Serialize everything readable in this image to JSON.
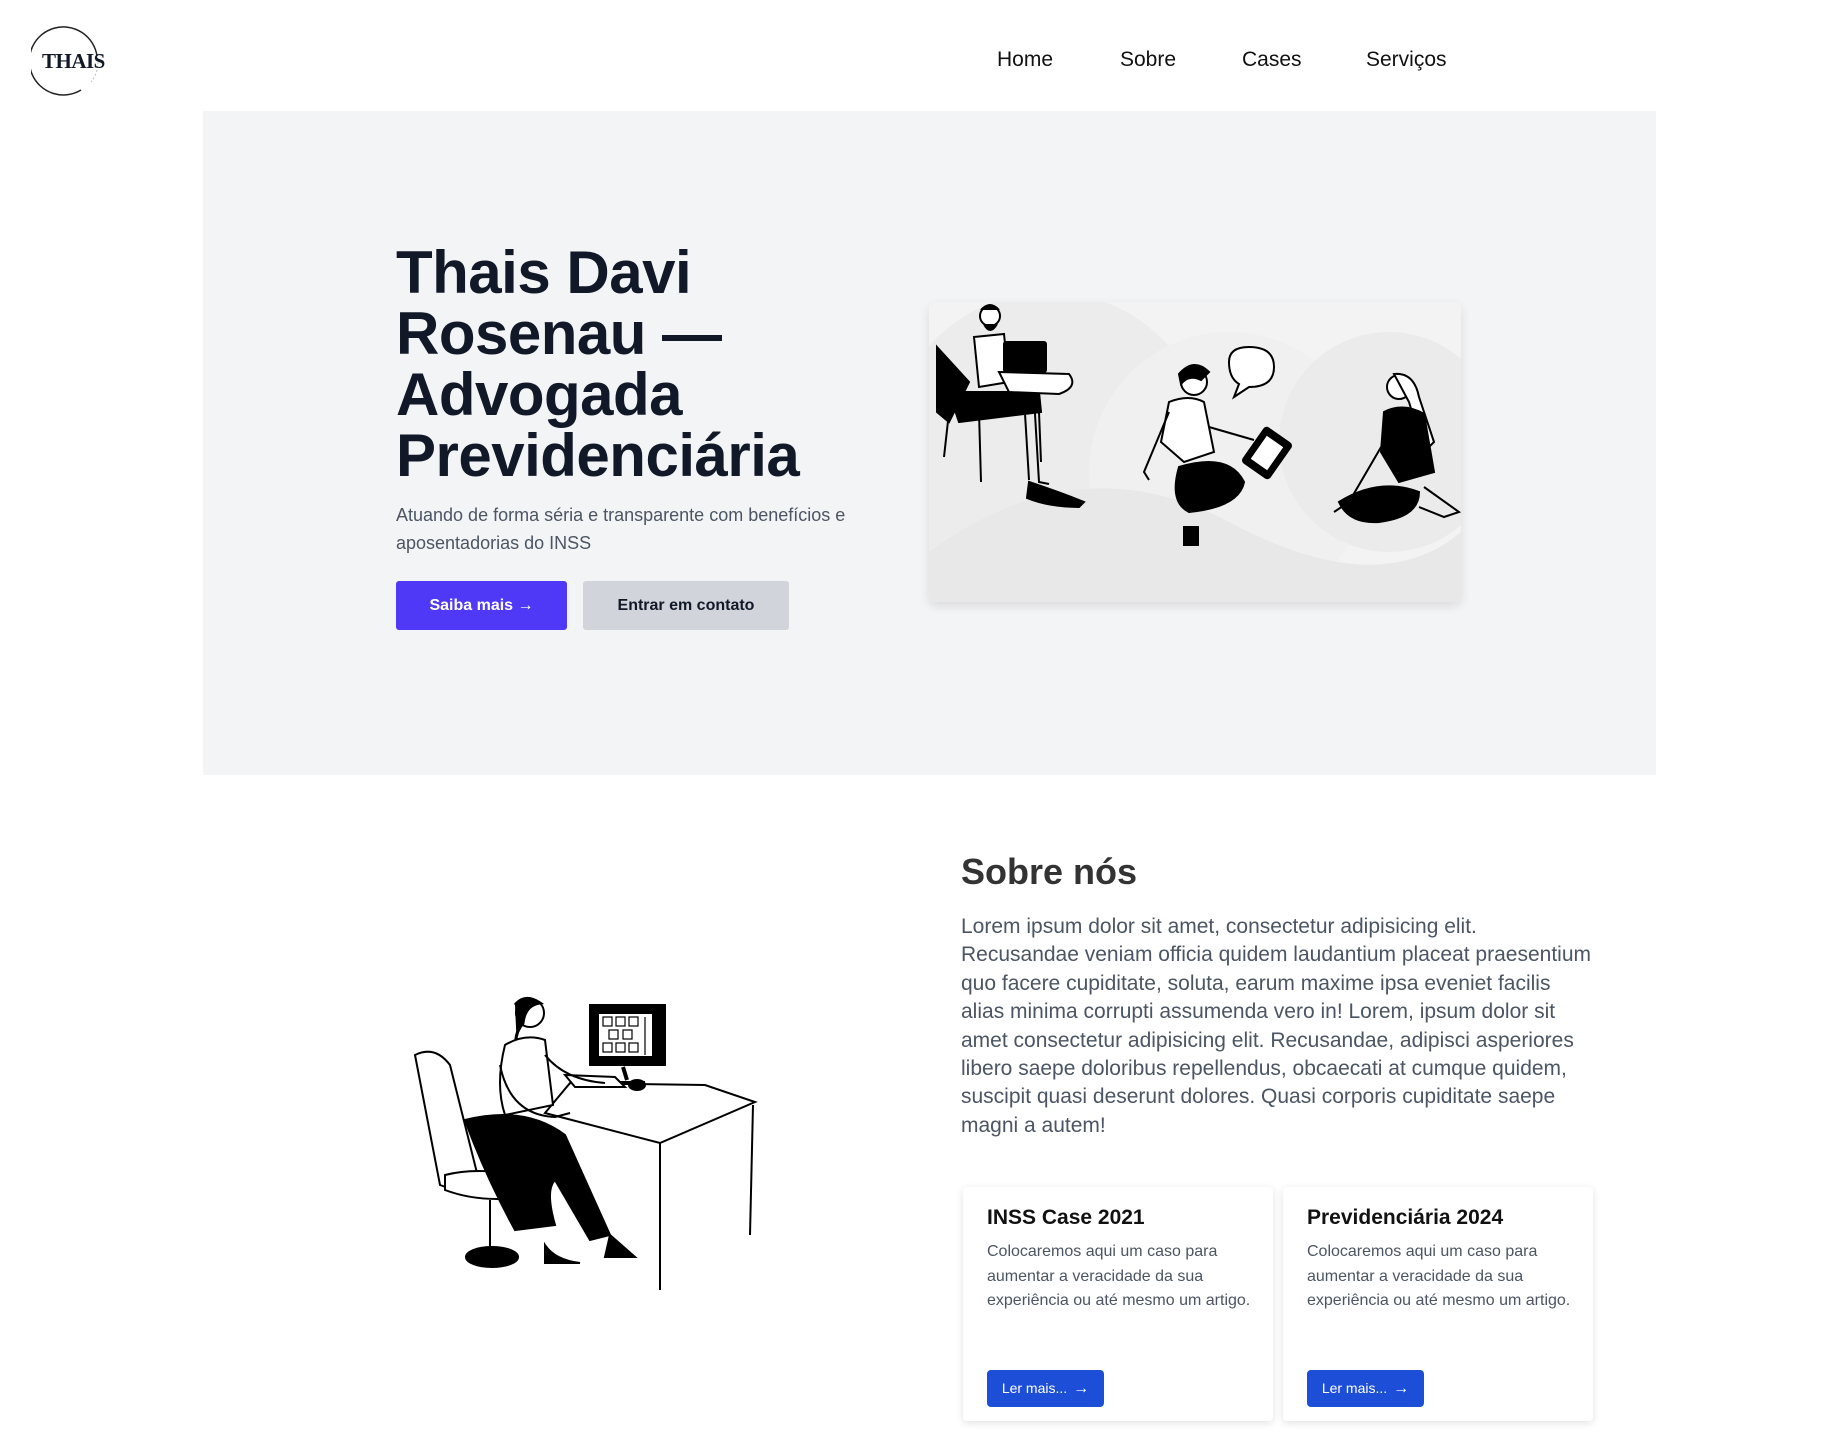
{
  "header": {
    "logo_text": "THAIS",
    "nav": [
      {
        "label": "Home"
      },
      {
        "label": "Sobre"
      },
      {
        "label": "Cases"
      },
      {
        "label": "Serviços"
      }
    ]
  },
  "hero": {
    "title": "Thais Davi Rosenau — Advogada Previdenciária",
    "subtitle": "Atuando de forma séria e transparente com benefícios e aposentadorias do INSS",
    "primary_button": "Saiba mais →",
    "secondary_button": "Entrar em contato"
  },
  "about": {
    "title": "Sobre nós",
    "text": "Lorem ipsum dolor sit amet, consectetur adipisicing elit. Recusandae veniam officia quidem laudantium placeat praesentium quo facere cupiditate, soluta, earum maxime ipsa eveniet facilis alias minima corrupti assumenda vero in! Lorem, ipsum dolor sit amet consectetur adipisicing elit. Recusandae, adipisci asperiores libero saepe doloribus repellendus, obcaecati at cumque quidem, suscipit quasi deserunt dolores. Quasi corporis cupiditate saepe magni a autem!",
    "cards": [
      {
        "title": "INSS Case 2021",
        "text": "Colocaremos aqui um caso para aumentar a veracidade da sua experiência ou até mesmo um artigo.",
        "button": "Ler mais..."
      },
      {
        "title": "Previdenciária 2024",
        "text": "Colocaremos aqui um caso para aumentar a veracidade da sua experiência ou até mesmo um artigo.",
        "button": "Ler mais..."
      }
    ]
  },
  "colors": {
    "primary": "#4f39f6",
    "card_button": "#1d4ed8",
    "hero_bg": "#f3f4f6"
  }
}
